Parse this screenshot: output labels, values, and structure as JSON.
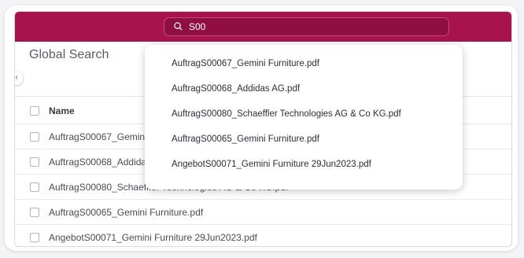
{
  "search": {
    "value": "S00"
  },
  "page": {
    "title": "Global Search",
    "collapse_glyph": "‹"
  },
  "table": {
    "header": "Name",
    "rows": [
      "AuftragS00067_Gemini Furniture.pdf",
      "AuftragS00068_Addidas AG.pdf",
      "AuftragS00080_Schaeffler Technologies AG & Co KG.pdf",
      "AuftragS00065_Gemini Furniture.pdf",
      "AngebotS00071_Gemini Furniture 29Jun2023.pdf"
    ]
  },
  "dropdown": {
    "items": [
      "AuftragS00067_Gemini Furniture.pdf",
      "AuftragS00068_Addidas AG.pdf",
      "AuftragS00080_Schaeffler Technologies AG & Co KG.pdf",
      "AuftragS00065_Gemini Furniture.pdf",
      "AngebotS00071_Gemini Furniture 29Jun2023.pdf"
    ]
  },
  "colors": {
    "topbar": "#a8134d",
    "search_box": "#8e0f40"
  }
}
